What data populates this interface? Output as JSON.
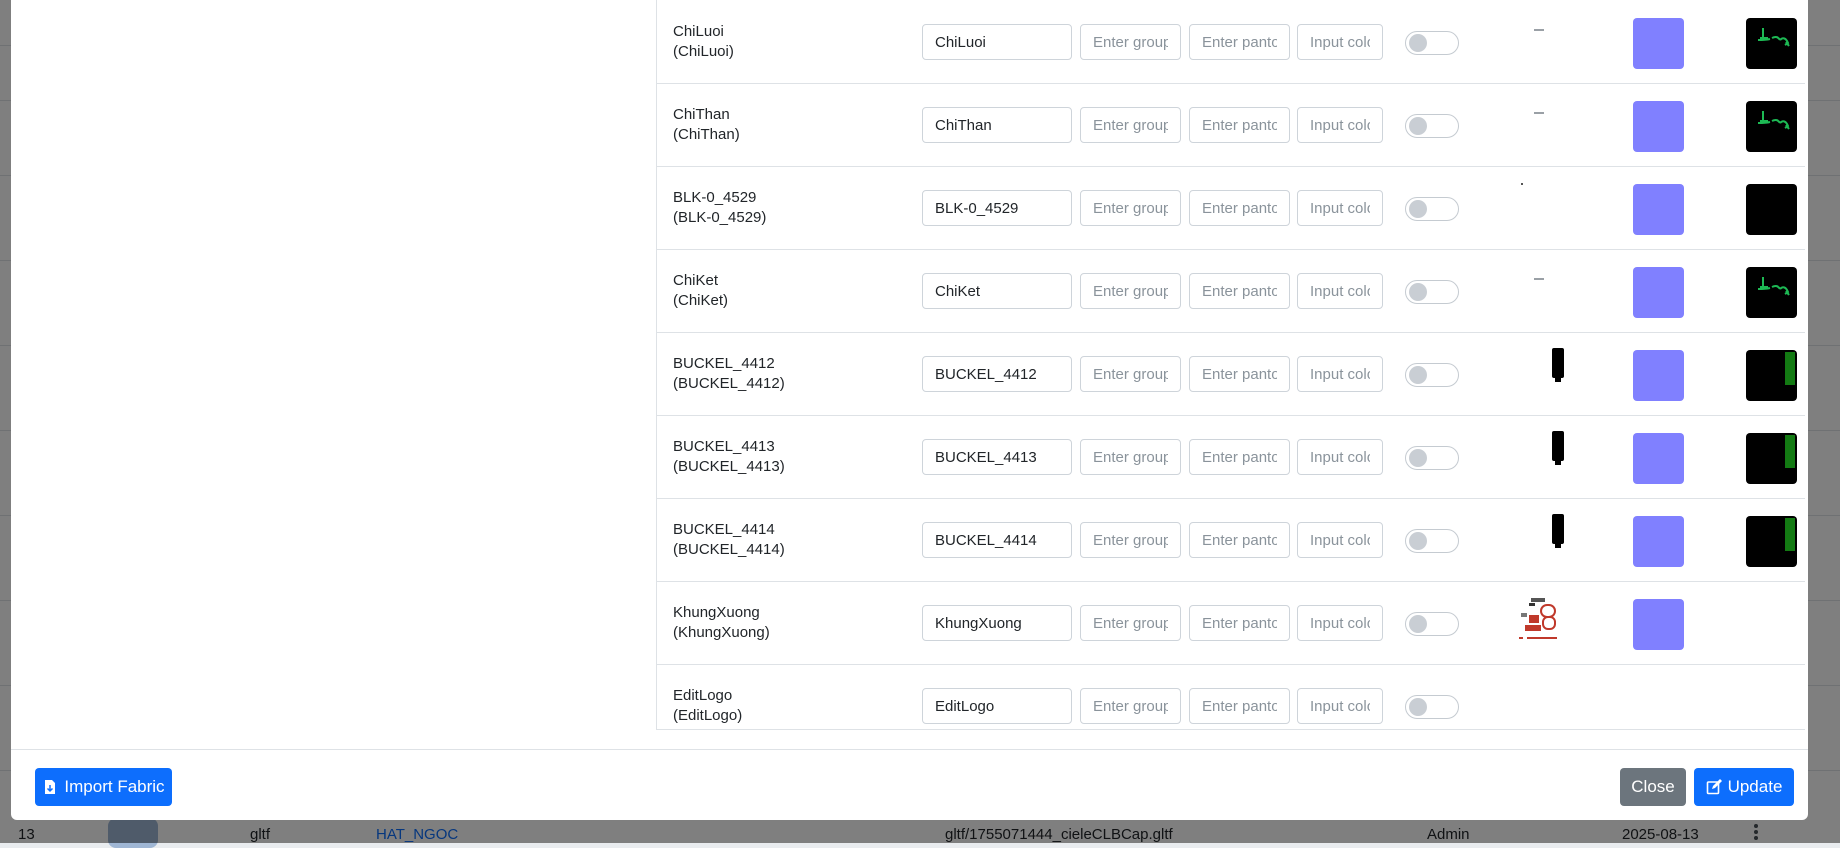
{
  "placeholders": {
    "group": "Enter group",
    "pantone": "Enter pantone",
    "color": "Input color"
  },
  "rows": [
    {
      "label": "ChiLuoi",
      "sub": "(ChiLuoi)",
      "value": "ChiLuoi",
      "thumb": "dash",
      "swatch": true,
      "preview": "green-leaf"
    },
    {
      "label": "ChiThan",
      "sub": "(ChiThan)",
      "value": "ChiThan",
      "thumb": "dash",
      "swatch": true,
      "preview": "green-leaf"
    },
    {
      "label": "BLK-0_4529",
      "sub": "(BLK-0_4529)",
      "value": "BLK-0_4529",
      "thumb": "dot",
      "swatch": true,
      "preview": "black"
    },
    {
      "label": "ChiKet",
      "sub": "(ChiKet)",
      "value": "ChiKet",
      "thumb": "dash",
      "swatch": true,
      "preview": "green-leaf"
    },
    {
      "label": "BUCKEL_4412",
      "sub": "(BUCKEL_4412)",
      "value": "BUCKEL_4412",
      "thumb": "buckle",
      "swatch": true,
      "preview": "black-green-strip"
    },
    {
      "label": "BUCKEL_4413",
      "sub": "(BUCKEL_4413)",
      "value": "BUCKEL_4413",
      "thumb": "buckle",
      "swatch": true,
      "preview": "black-green-strip"
    },
    {
      "label": "BUCKEL_4414",
      "sub": "(BUCKEL_4414)",
      "value": "BUCKEL_4414",
      "thumb": "buckle",
      "swatch": true,
      "preview": "black-green-strip"
    },
    {
      "label": "KhungXuong",
      "sub": "(KhungXuong)",
      "value": "KhungXuong",
      "thumb": "logo-texture",
      "swatch": true,
      "preview": "none"
    },
    {
      "label": "EditLogo",
      "sub": "(EditLogo)",
      "value": "EditLogo",
      "thumb": "none",
      "swatch": false,
      "preview": "none"
    }
  ],
  "footer": {
    "import_label": "Import Fabric",
    "close_label": "Close",
    "update_label": "Update"
  },
  "background_row": {
    "index": "13",
    "type": "gltf",
    "brand": "HAT_NGOC",
    "path": "gltf/1755071444_cieleCLBCap.gltf",
    "user": "Admin",
    "date": "2025-08-13"
  },
  "colors": {
    "swatch": "#8080ff",
    "primary": "#0d6efd",
    "secondary": "#6c757d",
    "preview_green": "#1db954"
  }
}
